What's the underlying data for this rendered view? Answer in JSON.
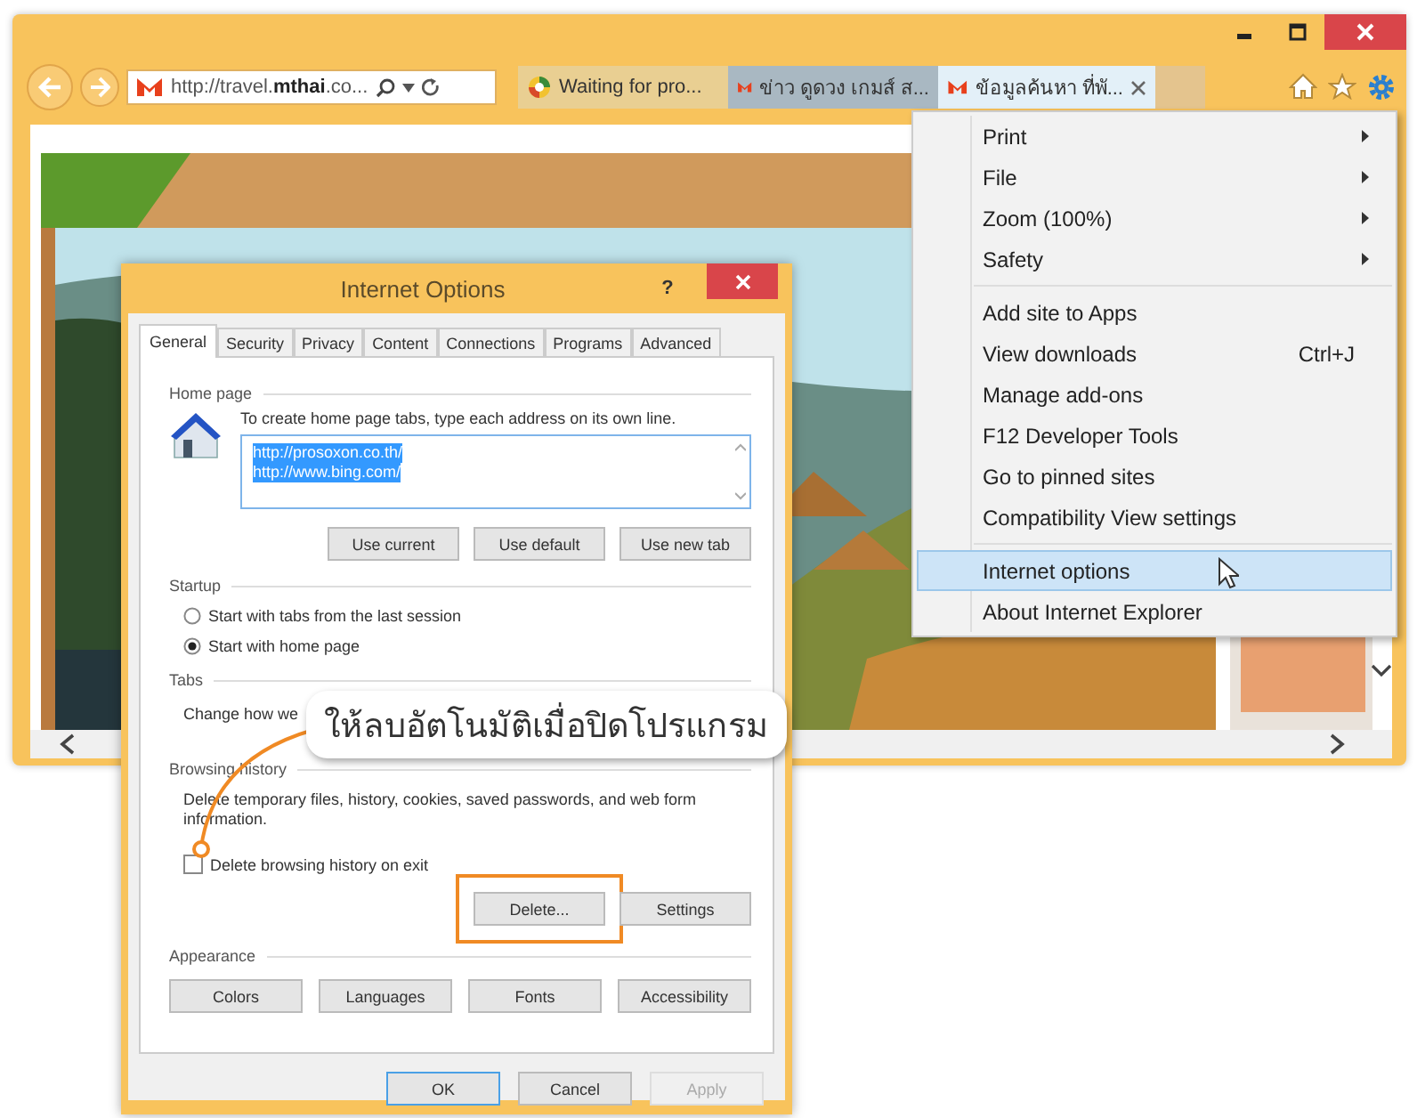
{
  "browser": {
    "address": "http://travel.**mthai**.co...",
    "tabs": [
      {
        "label": "Waiting for pro...",
        "selected": false,
        "kind": "loading"
      },
      {
        "label": "ข่าว ดูดวง เกมส์ ส...",
        "selected": false,
        "kind": "site"
      },
      {
        "label": "ข้อมูลค้นหา ที่พั...",
        "selected": true,
        "kind": "site"
      }
    ]
  },
  "tools_menu": {
    "items": [
      {
        "kind": "item",
        "label": "Print",
        "submenu": true,
        "selected": false
      },
      {
        "kind": "item",
        "label": "File",
        "submenu": true,
        "selected": false
      },
      {
        "kind": "item",
        "label": "Zoom (100%)",
        "submenu": true,
        "selected": false
      },
      {
        "kind": "item",
        "label": "Safety",
        "submenu": true,
        "selected": false
      },
      {
        "kind": "separator"
      },
      {
        "kind": "item",
        "label": "Add site to Apps",
        "selected": false
      },
      {
        "kind": "item",
        "label": "View downloads",
        "shortcut": "Ctrl+J",
        "selected": false
      },
      {
        "kind": "item",
        "label": "Manage add-ons",
        "selected": false
      },
      {
        "kind": "item",
        "label": "F12 Developer Tools",
        "selected": false
      },
      {
        "kind": "item",
        "label": "Go to pinned sites",
        "selected": false
      },
      {
        "kind": "item",
        "label": "Compatibility View settings",
        "selected": false
      },
      {
        "kind": "separator"
      },
      {
        "kind": "item",
        "label": "Internet options",
        "selected": true
      },
      {
        "kind": "item",
        "label": "About Internet Explorer",
        "selected": false
      }
    ]
  },
  "dialog": {
    "title": "Internet Options",
    "help": "?",
    "tabs": [
      {
        "label": "General",
        "selected": true
      },
      {
        "label": "Security",
        "selected": false
      },
      {
        "label": "Privacy",
        "selected": false
      },
      {
        "label": "Content",
        "selected": false
      },
      {
        "label": "Connections",
        "selected": false
      },
      {
        "label": "Programs",
        "selected": false
      },
      {
        "label": "Advanced",
        "selected": false
      }
    ],
    "home_page": {
      "heading": "Home page",
      "instruction": "To create home page tabs, type each address on its own line.",
      "urls": [
        "http://prosoxon.co.th/",
        "http://www.bing.com/"
      ],
      "buttons": [
        "Use current",
        "Use default",
        "Use new tab"
      ]
    },
    "startup": {
      "heading": "Startup",
      "options": [
        {
          "label": "Start with tabs from the last session",
          "selected": false
        },
        {
          "label": "Start with home page",
          "selected": true
        }
      ]
    },
    "tabs_section": {
      "heading": "Tabs",
      "text": "Change how we"
    },
    "browsing_history": {
      "heading": "Browsing history",
      "text": "Delete temporary files, history, cookies, saved passwords, and web form information.",
      "checkbox": {
        "label": "Delete browsing history on exit",
        "checked": false
      },
      "buttons": [
        {
          "label": "Delete...",
          "highlighted": true
        },
        {
          "label": "Settings",
          "highlighted": false
        }
      ]
    },
    "appearance": {
      "heading": "Appearance",
      "buttons": [
        "Colors",
        "Languages",
        "Fonts",
        "Accessibility"
      ]
    },
    "footer_buttons": [
      {
        "label": "OK",
        "default": true,
        "disabled": false
      },
      {
        "label": "Cancel",
        "default": false,
        "disabled": false
      },
      {
        "label": "Apply",
        "default": false,
        "disabled": true
      }
    ]
  },
  "callout": {
    "text": "ให้ลบอัตโนมัติเมื่อปิดโปรแกรม"
  }
}
